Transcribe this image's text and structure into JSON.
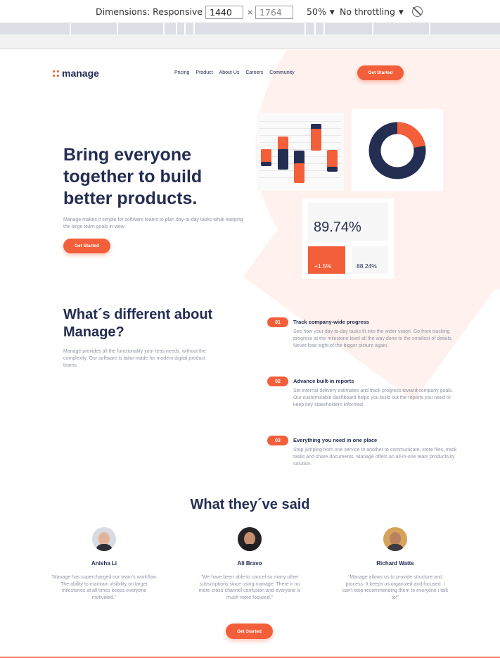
{
  "devtools": {
    "dimensions_label": "Dimensions: Responsive",
    "width_value": "1440",
    "height_placeholder": "1764",
    "times": "×",
    "zoom": "50%",
    "throttle": "No throttling"
  },
  "header": {
    "logo_text": "manage",
    "nav": [
      "Pricing",
      "Product",
      "About Us",
      "Careers",
      "Community"
    ],
    "cta": "Get Started"
  },
  "hero": {
    "title": "Bring everyone together to build better products.",
    "subtitle": "Manage makes it simple for software teams to plan day-to-day tasks while keeping the large team goals in view",
    "cta": "Get Started",
    "stat_main": "89.74%",
    "stat_change": "+1.5%",
    "stat_secondary": "88.24%"
  },
  "difference": {
    "title": "What´s different about Manage?",
    "subtitle": "Manage provides all the functionality your teas needs, without the complexity. Our software is tailor-made for modern digital product teams",
    "features": [
      {
        "num": "01",
        "title": "Track company-wide progress",
        "desc": "See how your day-to-day tasks fit into the wider vision. Go from tracking progress at the milestone level all the way done to the smallest of details. Never lose sight of the bigger picture again."
      },
      {
        "num": "02",
        "title": "Advance built-in reports",
        "desc": "Set internal delivery estimates and track progress toward company goals. Our customisable dashboard helps you build out the reports you need to keep key stakeholders informed."
      },
      {
        "num": "03",
        "title": "Everything you need in one place",
        "desc": "Stop jumping from one service to another to communicate, store files, track tasks and share documents. Manage offers an all-in-one team productivity solution."
      }
    ]
  },
  "testimonials": {
    "title": "What they´ve said",
    "items": [
      {
        "name": "Anisha Li",
        "quote": "“Manage has supercharged our team’s workflow. The ability to maintain visibility on larger milestones at all times keeps everyone motivated.”"
      },
      {
        "name": "Ali Bravo",
        "quote": "“We have been able to cancel so many other subscriptions since using manage. There ir no more cross-channel confusion and everyone is much more focused.”"
      },
      {
        "name": "Richard Watts",
        "quote": "“Manage allows us to provide structure and process. It keeps us organized and focused. I can't stop recommending them to everyone i talk to!”"
      }
    ],
    "cta": "Get Started"
  },
  "colors": {
    "accent": "#f25f3a",
    "navy": "#242d52",
    "muted": "#9095a7",
    "tint": "#fff1ed"
  }
}
